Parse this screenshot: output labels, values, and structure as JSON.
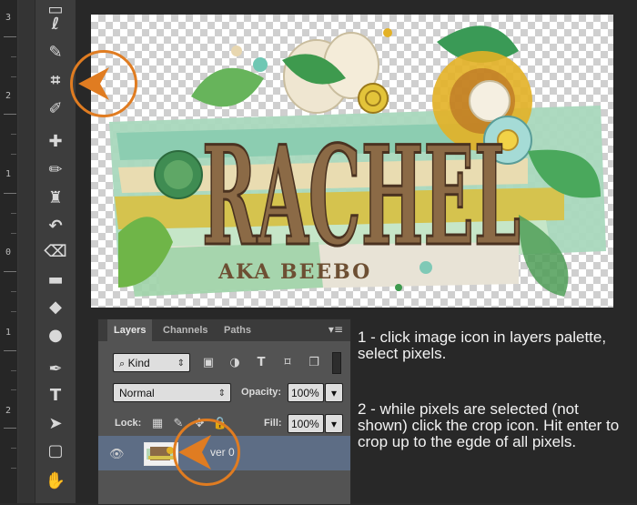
{
  "ruler": {
    "labels": [
      "3",
      "2",
      "1",
      "0",
      "1",
      "2"
    ]
  },
  "toolbar": {
    "tools": [
      {
        "name": "rectangular-marquee-icon",
        "glyph": "▭"
      },
      {
        "name": "lasso-icon",
        "glyph": "ℓ"
      },
      {
        "name": "quick-selection-icon",
        "glyph": "✎"
      },
      {
        "name": "crop-icon",
        "glyph": "⌗"
      },
      {
        "name": "eyedropper-icon",
        "glyph": "✐"
      },
      {
        "name": "spot-healing-icon",
        "glyph": "✚"
      },
      {
        "name": "brush-icon",
        "glyph": "✏"
      },
      {
        "name": "clone-stamp-icon",
        "glyph": "♜"
      },
      {
        "name": "history-brush-icon",
        "glyph": "↶"
      },
      {
        "name": "eraser-icon",
        "glyph": "⌫"
      },
      {
        "name": "gradient-icon",
        "glyph": "▬"
      },
      {
        "name": "blur-icon",
        "glyph": "◆"
      },
      {
        "name": "dodge-icon",
        "glyph": "●"
      },
      {
        "name": "pen-icon",
        "glyph": "✒"
      },
      {
        "name": "type-icon",
        "glyph": "T"
      },
      {
        "name": "path-selection-icon",
        "glyph": "➤"
      },
      {
        "name": "shape-icon",
        "glyph": "▢"
      },
      {
        "name": "hand-icon",
        "glyph": "✋"
      }
    ]
  },
  "artwork": {
    "title": "RACHEL",
    "subtitle": "AKA BEEBO"
  },
  "layers_panel": {
    "tabs": [
      "Layers",
      "Channels",
      "Paths"
    ],
    "active_tab": "Layers",
    "menu_glyph": "▾≡",
    "filter": {
      "value": "Kind",
      "arrow": "⇕"
    },
    "filter_icons": [
      {
        "name": "image-filter-icon",
        "glyph": "▣"
      },
      {
        "name": "adjustment-filter-icon",
        "glyph": "◑"
      },
      {
        "name": "type-filter-icon",
        "glyph": "T"
      },
      {
        "name": "shape-filter-icon",
        "glyph": "⌑"
      },
      {
        "name": "smart-object-filter-icon",
        "glyph": "❐"
      }
    ],
    "blend_mode": {
      "value": "Normal",
      "arrow": "⇕"
    },
    "opacity": {
      "label": "Opacity:",
      "value": "100%",
      "arrow": "▾"
    },
    "lock": {
      "label": "Lock:",
      "icons": [
        "▦",
        "✎",
        "✥",
        "🔒"
      ]
    },
    "fill": {
      "label": "Fill:",
      "value": "100%",
      "arrow": "▾"
    },
    "layer": {
      "visibility_glyph": "👁",
      "name": "ver 0"
    }
  },
  "annotations": {
    "accent_color": "#e07c21",
    "note_1": "1 - click image icon in layers palette, select pixels.",
    "note_2": "2 - while pixels are selected (not shown) click the crop icon. Hit enter to crop up to the egde of all pixels."
  }
}
